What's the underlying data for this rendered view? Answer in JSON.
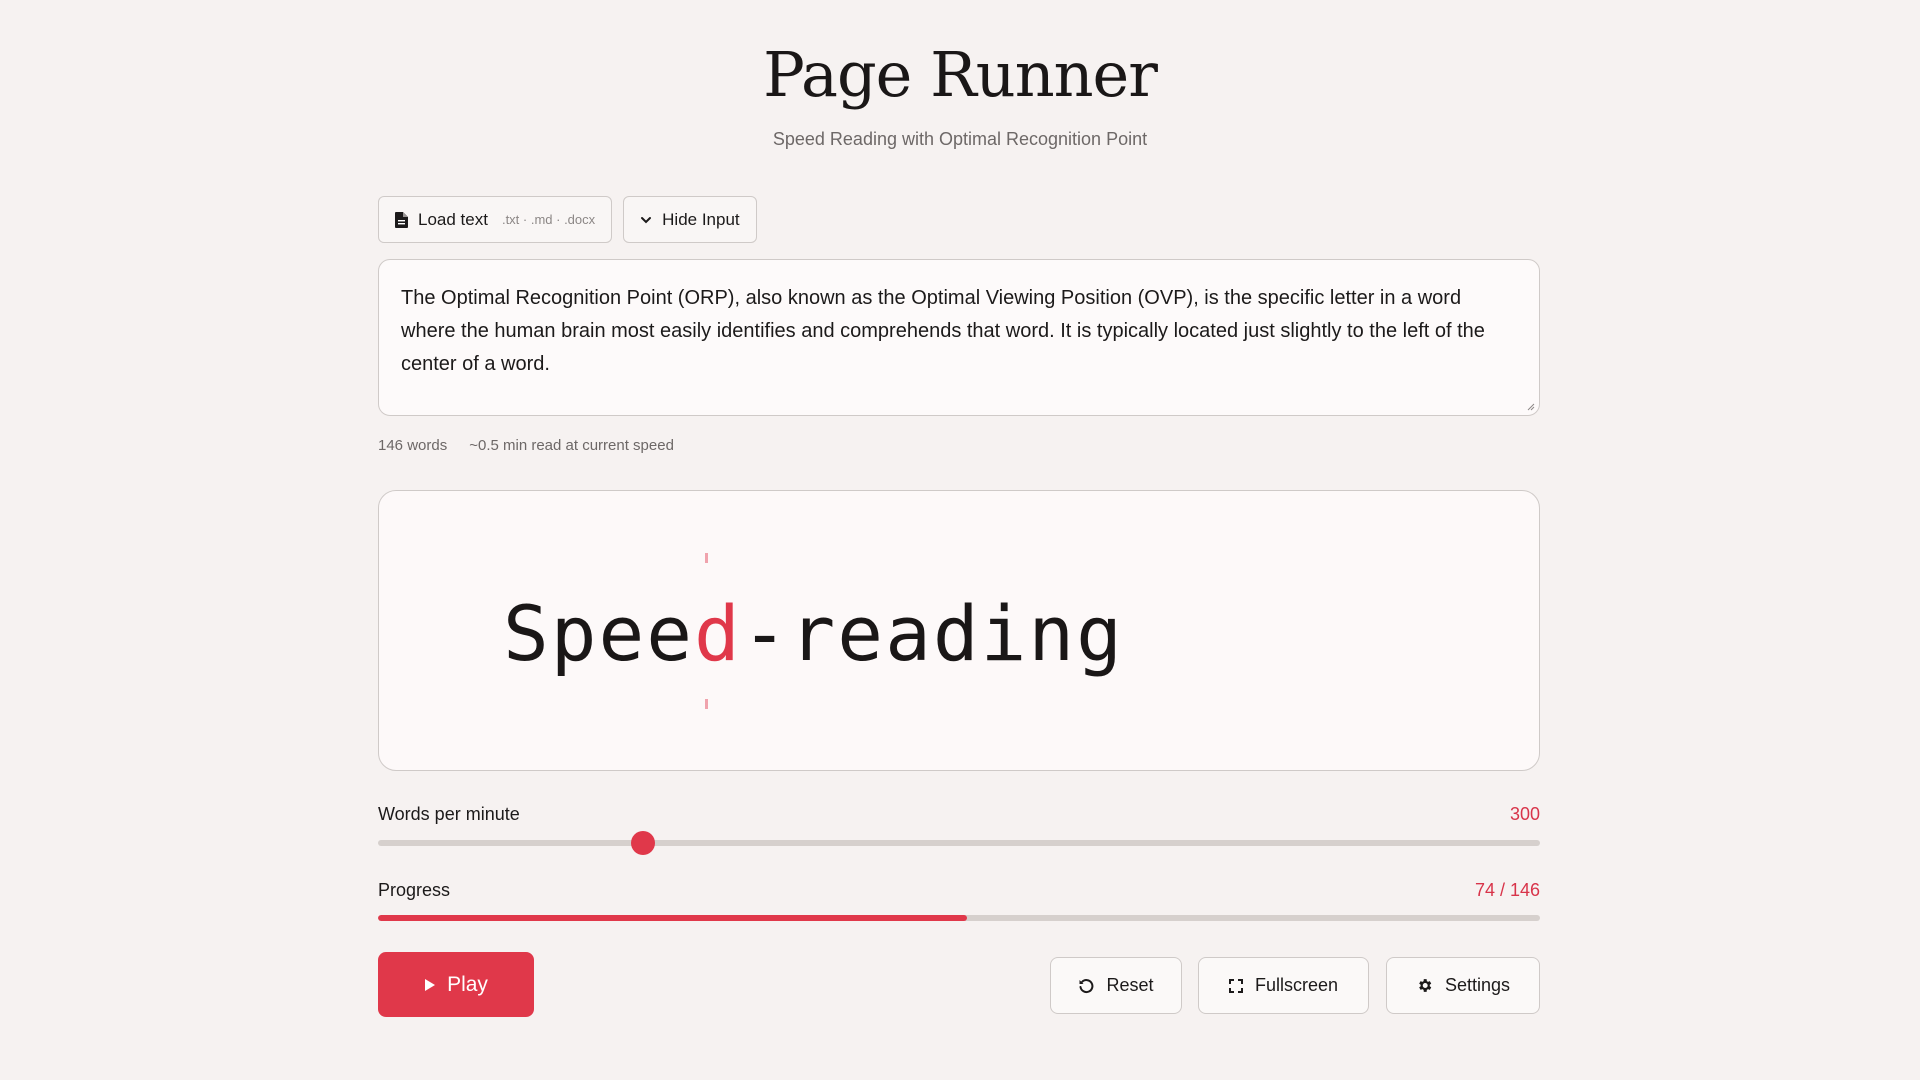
{
  "header": {
    "title": "Page Runner",
    "subtitle": "Speed Reading with Optimal Recognition Point"
  },
  "toolbar": {
    "load_label": "Load text",
    "load_hint": ".txt · .md · .docx",
    "hide_label": "Hide Input",
    "load_icon": "file-icon",
    "hide_icon": "chevron-down-icon"
  },
  "input": {
    "text": "The Optimal Recognition Point (ORP), also known as the Optimal Viewing Position (OVP), is the specific letter in a word where the human brain most easily identifies and comprehends that word. It is typically located just slightly to the left of the center of a word."
  },
  "stats": {
    "word_count": "146 words",
    "read_time": "~0.5 min read at current speed"
  },
  "reader": {
    "before": "Spee",
    "focus": "d",
    "after": "-reading"
  },
  "wpm": {
    "label": "Words per minute",
    "value": "300",
    "fraction": 0.228
  },
  "progress": {
    "label": "Progress",
    "value": "74 / 146",
    "current": 74,
    "total": 146
  },
  "controls": {
    "play_label": "Play",
    "reset_label": "Reset",
    "fullscreen_label": "Fullscreen",
    "settings_label": "Settings"
  },
  "colors": {
    "accent": "#e0384a",
    "background": "#f6f2f1"
  }
}
